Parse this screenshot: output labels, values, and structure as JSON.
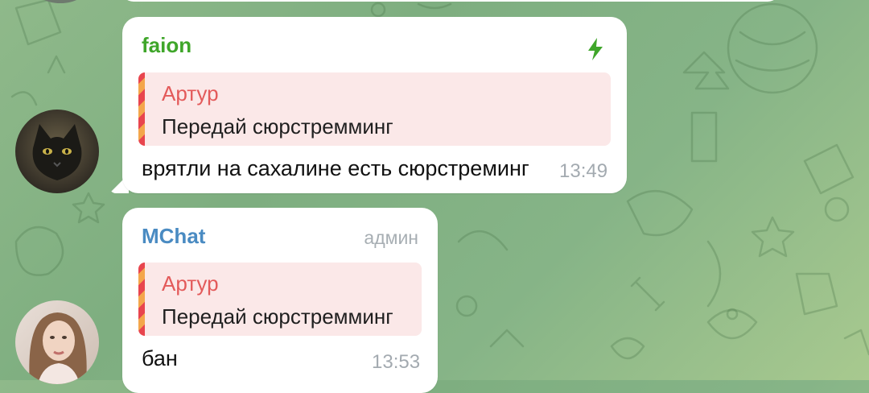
{
  "messages": [
    {
      "sender": "faion",
      "reply": {
        "author": "Артур",
        "text": "Передай сюрстремминг"
      },
      "text": "врятли на сахалине есть сюрстреминг",
      "time": "13:49",
      "icon": "lightning-icon",
      "sender_color": "#3fa62a"
    },
    {
      "sender": "MChat",
      "badge": "админ",
      "reply": {
        "author": "Артур",
        "text": "Передай сюрстремминг"
      },
      "text": "бан",
      "time": "13:53",
      "sender_color": "#4a8bc2"
    }
  ],
  "colors": {
    "reply_author": "#e35a5a",
    "reply_bg": "#fbe8e8",
    "time": "#a3aab0"
  }
}
